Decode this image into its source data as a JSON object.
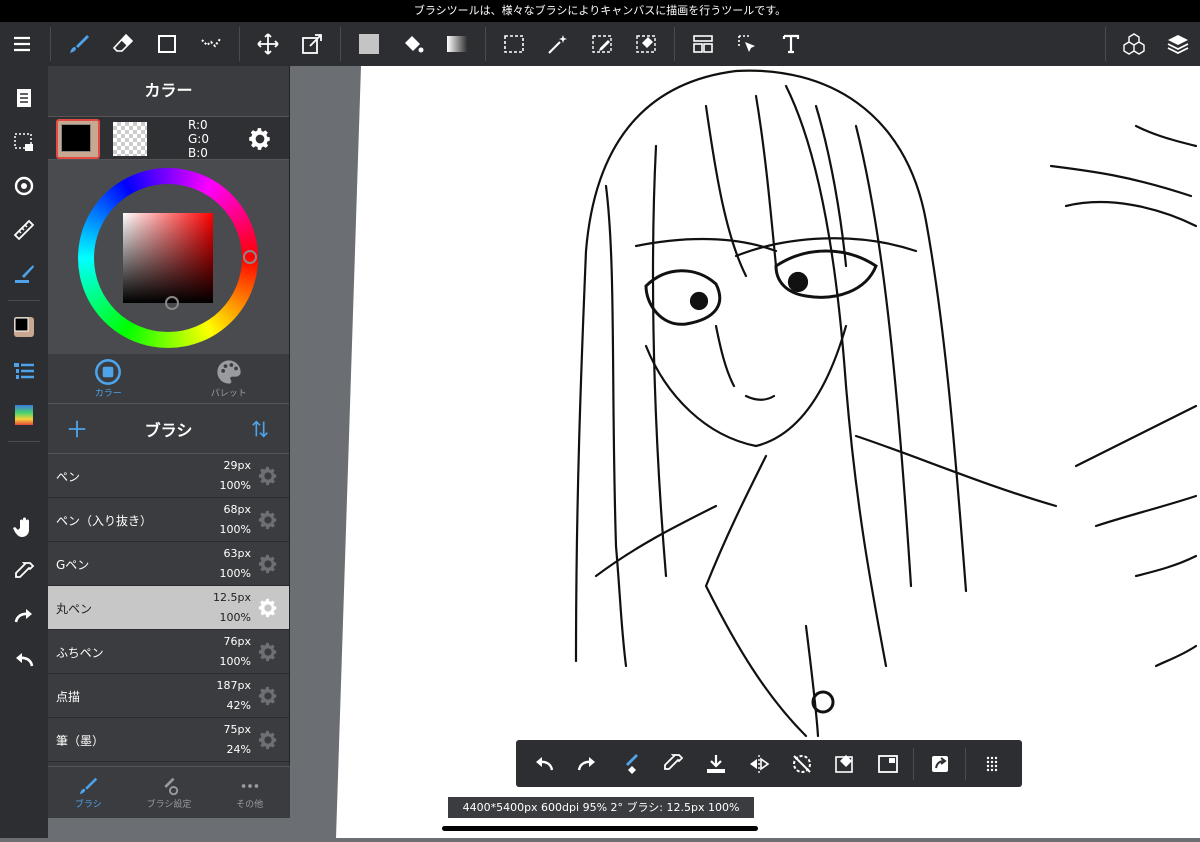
{
  "status_tip": "ブラシツールは、様々なブラシによりキャンバスに描画を行うツールです。",
  "panel": {
    "title": "カラー",
    "rgb": {
      "r": "R:0",
      "g": "G:0",
      "b": "B:0"
    },
    "tabs": [
      {
        "label": "カラー"
      },
      {
        "label": "パレット"
      }
    ]
  },
  "brush": {
    "title": "ブラシ",
    "items": [
      {
        "name": "ペン",
        "size": "29px",
        "opacity": "100%"
      },
      {
        "name": "ペン（入り抜き）",
        "size": "68px",
        "opacity": "100%"
      },
      {
        "name": "Gペン",
        "size": "63px",
        "opacity": "100%"
      },
      {
        "name": "丸ペン",
        "size": "12.5px",
        "opacity": "100%"
      },
      {
        "name": "ふちペン",
        "size": "76px",
        "opacity": "100%"
      },
      {
        "name": "点描",
        "size": "187px",
        "opacity": "42%"
      },
      {
        "name": "筆（墨）",
        "size": "75px",
        "opacity": "24%"
      }
    ],
    "selected_index": 3
  },
  "bottom_tabs": [
    {
      "label": "ブラシ"
    },
    {
      "label": "ブラシ設定"
    },
    {
      "label": "その他"
    }
  ],
  "status_bar": "4400*5400px 600dpi 95% 2° ブラシ: 12.5px 100%",
  "colors": {
    "accent": "#4ea3ea",
    "toolbar": "#2d2e31",
    "panel": "#3b3c3f"
  },
  "icons": {
    "toolbar": [
      "menu-icon",
      "brush-icon",
      "eraser-icon",
      "rectangle-icon",
      "dot-icon",
      "move-icon",
      "transform-icon",
      "fill-color-icon",
      "bucket-icon",
      "gradient-icon",
      "select-rect-icon",
      "magic-wand-icon",
      "select-pen-icon",
      "select-eraser-icon",
      "panel-layout-icon",
      "select-move-icon",
      "text-icon",
      "3d-icon",
      "layers-icon"
    ]
  }
}
